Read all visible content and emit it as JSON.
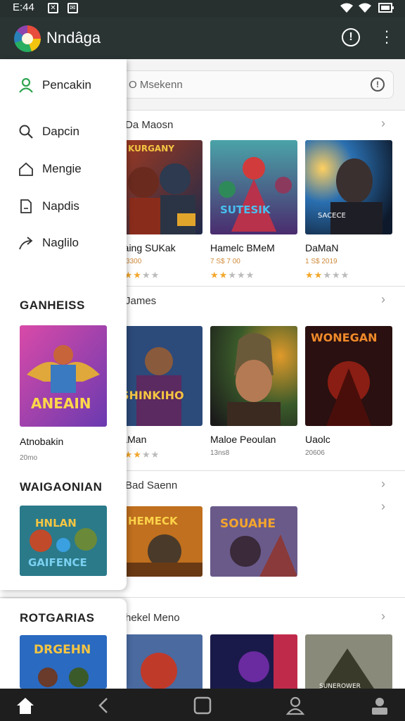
{
  "status_bar": {
    "time": "E:44"
  },
  "app_bar": {
    "title": "Nndâga"
  },
  "search": {
    "placeholder": "O Msekenn"
  },
  "drawer": {
    "items": [
      {
        "label": "Pencakin",
        "icon": "user-icon"
      },
      {
        "label": "Dapcin",
        "icon": "search-icon"
      },
      {
        "label": "Mengie",
        "icon": "home-icon"
      },
      {
        "label": "Napdis",
        "icon": "document-icon"
      },
      {
        "label": "Naglilo",
        "icon": "share-icon"
      }
    ],
    "section1_title": "GANHEISS",
    "card1": {
      "name": "Atnobakin",
      "sub": "20mo",
      "art": "ANEAIN"
    },
    "section2_title": "WAIGAONIAN",
    "card2": {
      "art": "GAIFENCE"
    },
    "section3_title": "ROTGARIAS",
    "card3": {
      "art": "DRGEHN"
    }
  },
  "sections": [
    {
      "title": "Da Maosn",
      "cards": [
        {
          "name": "Maing SUKak",
          "sub": "S$ 3300",
          "stars": 3,
          "art": "KURGANY"
        },
        {
          "name": "Hamelc BMeM",
          "sub": "7 S$ 7 00",
          "stars": 2,
          "art": "SUTESIK"
        },
        {
          "name": "DaMaN",
          "sub": "1 S$ 2019",
          "stars": 2,
          "art": "SACECE"
        }
      ]
    },
    {
      "title": "James",
      "cards": [
        {
          "name": "KaMan",
          "sub": "",
          "stars": 3,
          "art": "SHINKIHO"
        },
        {
          "name": "Maloe Peoulan",
          "sub": "13ns8",
          "stars": 0,
          "art": ""
        },
        {
          "name": "Uaolc",
          "sub": "20606",
          "stars": 0,
          "art": "WONEGAN"
        }
      ]
    },
    {
      "title": "Bad Saenn",
      "cards": [
        {
          "name": "",
          "sub": "",
          "stars": 0,
          "art": "HEMECK"
        },
        {
          "name": "",
          "sub": "",
          "stars": 0,
          "art": "SOUAHE"
        }
      ]
    },
    {
      "title": "hekel Meno",
      "cards": [
        {
          "art": ""
        },
        {
          "art": ""
        },
        {
          "art": "SUNEROWER"
        }
      ]
    }
  ],
  "colors": {
    "app_bar": "#2a3433",
    "accent_green": "#2ea44f",
    "star": "#f2a72c",
    "price": "#d08a3b"
  }
}
